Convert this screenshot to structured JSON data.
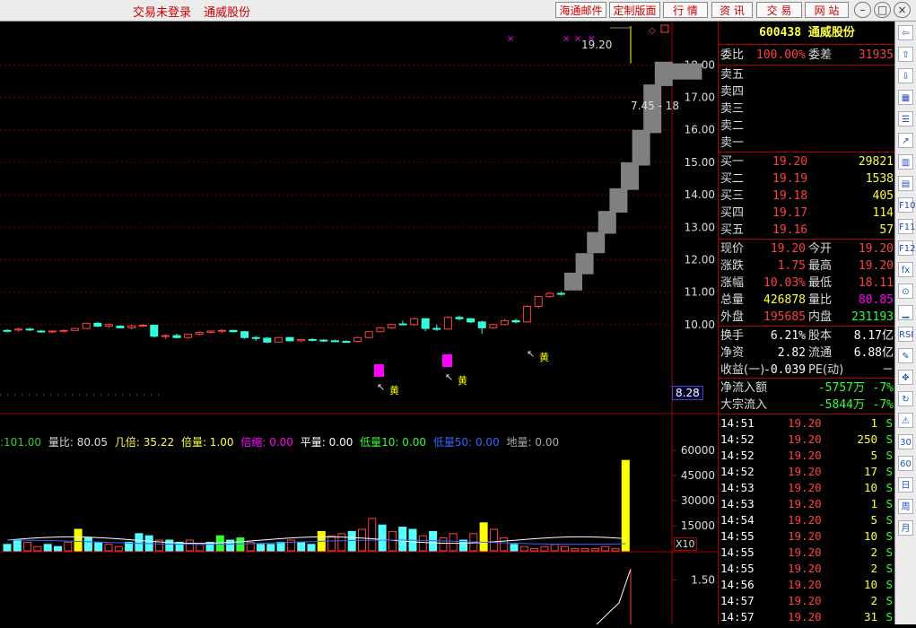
{
  "topbar": {
    "status_text": "交易未登录",
    "stock_name": "通威股份",
    "buttons": [
      "海通邮件",
      "定制版面",
      "行 情",
      "资 讯",
      "交 易",
      "网 站"
    ],
    "window_controls": [
      "minimize-icon",
      "restore-icon",
      "close-icon"
    ]
  },
  "quote": {
    "code": "600438",
    "name": "通威股份",
    "wei_bi_label": "委比",
    "wei_bi": "100.00%",
    "wei_cha_label": "委差",
    "wei_cha": "31935",
    "sells": [
      {
        "label": "卖五",
        "price": "",
        "vol": ""
      },
      {
        "label": "卖四",
        "price": "",
        "vol": ""
      },
      {
        "label": "卖三",
        "price": "",
        "vol": ""
      },
      {
        "label": "卖二",
        "price": "",
        "vol": ""
      },
      {
        "label": "卖一",
        "price": "",
        "vol": ""
      }
    ],
    "buys": [
      {
        "label": "买一",
        "price": "19.20",
        "vol": "29821"
      },
      {
        "label": "买二",
        "price": "19.19",
        "vol": "1538"
      },
      {
        "label": "买三",
        "price": "19.18",
        "vol": "405"
      },
      {
        "label": "买四",
        "price": "19.17",
        "vol": "114"
      },
      {
        "label": "买五",
        "price": "19.16",
        "vol": "57"
      }
    ],
    "stats": [
      {
        "l1": "现价",
        "v1": "19.20",
        "c1": "red",
        "l2": "今开",
        "v2": "19.20",
        "c2": "red"
      },
      {
        "l1": "涨跌",
        "v1": "1.75",
        "c1": "red",
        "l2": "最高",
        "v2": "19.20",
        "c2": "red"
      },
      {
        "l1": "涨幅",
        "v1": "10.03%",
        "c1": "red",
        "l2": "最低",
        "v2": "18.11",
        "c2": "red"
      },
      {
        "l1": "总量",
        "v1": "426878",
        "c1": "yel",
        "l2": "量比",
        "v2": "80.85",
        "c2": "mag"
      },
      {
        "l1": "外盘",
        "v1": "195685",
        "c1": "red",
        "l2": "内盘",
        "v2": "231193",
        "c2": "grn"
      }
    ],
    "stats2": [
      {
        "l1": "换手",
        "v1": "6.21%",
        "c1": "wht",
        "l2": "股本",
        "v2": "8.17亿",
        "c2": "wht"
      },
      {
        "l1": "净资",
        "v1": "2.82",
        "c1": "wht",
        "l2": "流通",
        "v2": "6.88亿",
        "c2": "wht"
      },
      {
        "l1": "收益(一)",
        "v1": "-0.039",
        "c1": "wht",
        "l2": "PE(动)",
        "v2": "－",
        "c2": "wht"
      }
    ],
    "flows": [
      {
        "label": "净流入额",
        "value": "-5757万",
        "pct": "-7%"
      },
      {
        "label": "大宗流入",
        "value": "-5844万",
        "pct": "-7%"
      }
    ]
  },
  "ticks": [
    {
      "time": "14:51",
      "price": "19.20",
      "vol": "1",
      "side": "S"
    },
    {
      "time": "14:52",
      "price": "19.20",
      "vol": "250",
      "side": "S"
    },
    {
      "time": "14:52",
      "price": "19.20",
      "vol": "5",
      "side": "S"
    },
    {
      "time": "14:52",
      "price": "19.20",
      "vol": "17",
      "side": "S"
    },
    {
      "time": "14:53",
      "price": "19.20",
      "vol": "10",
      "side": "S"
    },
    {
      "time": "14:53",
      "price": "19.20",
      "vol": "1",
      "side": "S"
    },
    {
      "time": "14:54",
      "price": "19.20",
      "vol": "5",
      "side": "S"
    },
    {
      "time": "14:55",
      "price": "19.20",
      "vol": "10",
      "side": "S"
    },
    {
      "time": "14:55",
      "price": "19.20",
      "vol": "2",
      "side": "S"
    },
    {
      "time": "14:55",
      "price": "19.20",
      "vol": "2",
      "side": "S"
    },
    {
      "time": "14:56",
      "price": "19.20",
      "vol": "10",
      "side": "S"
    },
    {
      "time": "14:57",
      "price": "19.20",
      "vol": "2",
      "side": "S"
    },
    {
      "time": "14:57",
      "price": "19.20",
      "vol": "31",
      "side": "S"
    }
  ],
  "price_axis": [
    "18.00",
    "17.00",
    "16.00",
    "15.00",
    "14.00",
    "13.00",
    "12.00",
    "11.00",
    "10.00"
  ],
  "price_axis_values": [
    18,
    17,
    16,
    15,
    14,
    13,
    12,
    11,
    10
  ],
  "current_price_tag": "8.28",
  "high_label": "19.20",
  "range_label": "7.45 - 18",
  "yellow_marker_text": "黄",
  "indicator_bar": [
    {
      "text": ":101.00",
      "color": "#3c3"
    },
    {
      "text": "量比: 80.05",
      "color": "#ddd"
    },
    {
      "text": "几倍: 35.22",
      "color": "#ff4"
    },
    {
      "text": "倍量: 1.00",
      "color": "#ff4"
    },
    {
      "text": "倍缩: 0.00",
      "color": "#f0f"
    },
    {
      "text": "平量: 0.00",
      "color": "#fff"
    },
    {
      "text": "低量10: 0.00",
      "color": "#3f3"
    },
    {
      "text": "低量50: 0.00",
      "color": "#36f"
    },
    {
      "text": "地量: 0.00",
      "color": "#aaa"
    }
  ],
  "volume_axis": [
    "60000",
    "45000",
    "30000",
    "15000"
  ],
  "volume_axis_values": [
    60000,
    45000,
    30000,
    15000
  ],
  "volume_unit": "X10",
  "bottom_axis": [
    "1.50",
    "1.00"
  ],
  "bottom_axis_values": [
    1.5,
    1.0
  ],
  "sidebar_icons": [
    "back-icon",
    "up-icon",
    "down-icon",
    "grid-icon",
    "list-icon",
    "trend-icon",
    "kline-icon",
    "report-icon",
    "f10-icon",
    "f11-icon",
    "f12-icon",
    "fx-icon",
    "search-icon",
    "chart-icon",
    "rsi-icon",
    "pen-icon",
    "move-icon",
    "refresh-icon",
    "warn-icon",
    "num30",
    "num60",
    "day-icon",
    "week-icon",
    "month-icon"
  ],
  "sidebar_labels": [
    "RSI",
    "30",
    "60",
    "日",
    "周"
  ],
  "chart_data": {
    "type": "candlestick",
    "y_range": [
      7.45,
      19.2
    ],
    "high": 19.2,
    "candles": [
      [
        9.82,
        9.86,
        9.76,
        9.8
      ],
      [
        9.83,
        9.9,
        9.78,
        9.86
      ],
      [
        9.86,
        9.9,
        9.8,
        9.84
      ],
      [
        9.8,
        9.84,
        9.75,
        9.78
      ],
      [
        9.78,
        9.82,
        9.74,
        9.8
      ],
      [
        9.8,
        9.85,
        9.76,
        9.82
      ],
      [
        9.82,
        9.9,
        9.8,
        9.88
      ],
      [
        9.88,
        10.06,
        9.86,
        10.04
      ],
      [
        10.04,
        10.08,
        9.92,
        9.95
      ],
      [
        9.95,
        10.02,
        9.9,
        10.0
      ],
      [
        9.95,
        9.98,
        9.88,
        9.9
      ],
      [
        9.9,
        10.0,
        9.86,
        9.96
      ],
      [
        9.96,
        10.02,
        9.92,
        9.98
      ],
      [
        9.98,
        10.0,
        9.6,
        9.64
      ],
      [
        9.64,
        9.7,
        9.55,
        9.66
      ],
      [
        9.66,
        9.72,
        9.58,
        9.6
      ],
      [
        9.6,
        9.72,
        9.56,
        9.7
      ],
      [
        9.7,
        9.8,
        9.66,
        9.76
      ],
      [
        9.76,
        9.82,
        9.72,
        9.8
      ],
      [
        9.8,
        9.86,
        9.74,
        9.82
      ],
      [
        9.82,
        9.84,
        9.76,
        9.78
      ],
      [
        9.78,
        9.8,
        9.56,
        9.6
      ],
      [
        9.6,
        9.65,
        9.5,
        9.58
      ],
      [
        9.58,
        9.62,
        9.42,
        9.46
      ],
      [
        9.46,
        9.62,
        9.44,
        9.6
      ],
      [
        9.6,
        9.62,
        9.48,
        9.5
      ],
      [
        9.5,
        9.56,
        9.46,
        9.54
      ],
      [
        9.54,
        9.58,
        9.48,
        9.52
      ],
      [
        9.52,
        9.55,
        9.46,
        9.5
      ],
      [
        9.5,
        9.54,
        9.46,
        9.48
      ],
      [
        9.48,
        9.52,
        9.44,
        9.46
      ],
      [
        9.48,
        9.62,
        9.46,
        9.6
      ],
      [
        9.6,
        9.8,
        9.58,
        9.78
      ],
      [
        9.78,
        9.92,
        9.76,
        9.9
      ],
      [
        9.9,
        10.02,
        9.86,
        10.0
      ],
      [
        10.02,
        10.12,
        9.98,
        10.0
      ],
      [
        10.0,
        10.22,
        9.96,
        10.18
      ],
      [
        10.18,
        10.2,
        9.8,
        9.88
      ],
      [
        9.88,
        10.0,
        9.8,
        9.86
      ],
      [
        9.86,
        10.26,
        9.84,
        10.22
      ],
      [
        10.22,
        10.28,
        10.12,
        10.18
      ],
      [
        10.18,
        10.2,
        10.04,
        10.08
      ],
      [
        10.08,
        10.12,
        9.72,
        9.9
      ],
      [
        9.9,
        10.02,
        9.86,
        10.0
      ],
      [
        10.0,
        10.16,
        9.98,
        10.12
      ],
      [
        10.12,
        10.18,
        10.04,
        10.08
      ],
      [
        10.08,
        10.6,
        10.06,
        10.56
      ],
      [
        10.56,
        10.9,
        10.5,
        10.86
      ],
      [
        10.86,
        11.0,
        10.82,
        10.96
      ],
      [
        10.96,
        11.02,
        10.9,
        10.94
      ]
    ],
    "limit_up_blocks": [
      [
        11.05,
        11.6
      ],
      [
        11.55,
        12.2
      ],
      [
        12.2,
        12.85
      ],
      [
        12.8,
        13.5
      ],
      [
        13.45,
        14.2
      ],
      [
        14.15,
        15.0
      ],
      [
        14.9,
        16.0
      ],
      [
        15.9,
        17.4
      ],
      [
        17.35,
        18.1
      ],
      [
        17.55,
        18.05
      ]
    ],
    "volumes": [
      3,
      5,
      4,
      2,
      3,
      2,
      4,
      10,
      6,
      4,
      3,
      2,
      4,
      8,
      7,
      5,
      5,
      4,
      5,
      3,
      4,
      7,
      5,
      6,
      4,
      3,
      3,
      4,
      5,
      4,
      3,
      9,
      7,
      8,
      9,
      10,
      15,
      12,
      9,
      11,
      10,
      7,
      9,
      6,
      8,
      5,
      8,
      13,
      10,
      6,
      3,
      2,
      1,
      2,
      3,
      2,
      1,
      1,
      1,
      2,
      1,
      42
    ],
    "volume_colors": [
      "cyan",
      "cyan",
      "red",
      "red",
      "cyan",
      "cyan",
      "red",
      "yellow",
      "cyan",
      "cyan",
      "red",
      "red",
      "cyan",
      "cyan",
      "cyan",
      "red",
      "cyan",
      "cyan",
      "red",
      "red",
      "cyan",
      "green",
      "cyan",
      "green",
      "red",
      "cyan",
      "cyan",
      "cyan",
      "red",
      "cyan",
      "cyan",
      "yellow",
      "red",
      "red",
      "cyan",
      "red",
      "red",
      "cyan",
      "red",
      "cyan",
      "cyan",
      "red",
      "cyan",
      "red",
      "red",
      "cyan",
      "red",
      "yellow",
      "red",
      "red",
      "cyan",
      "red",
      "red",
      "red",
      "red",
      "red",
      "red",
      "red",
      "red",
      "red",
      "red",
      "yellow"
    ]
  }
}
